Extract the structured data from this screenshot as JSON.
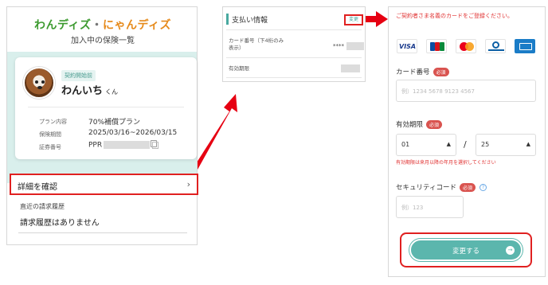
{
  "colors": {
    "accent": "#5bb6ad",
    "highlight": "#e02020",
    "logo_green": "#3c9a2f",
    "logo_orange": "#e68a1b"
  },
  "panel1": {
    "logo_left": "わんディズ",
    "logo_dot": "・",
    "logo_right": "にゃんディズ",
    "subtitle": "加入中の保険一覧",
    "card": {
      "badge": "契約開始前",
      "pet_name": "わんいち",
      "pet_suffix": "くん",
      "rows": [
        {
          "label": "プラン内容",
          "value": "70%補償プラン"
        },
        {
          "label": "保険期間",
          "value": "2025/03/16~2026/03/15"
        },
        {
          "label": "証券番号",
          "value": "PPR"
        }
      ],
      "copy_icon": "copy-icon"
    },
    "details_label": "詳細を確認",
    "details_icon": "chevron-right-icon",
    "billing_heading": "直近の請求履歴",
    "billing_text": "請求履歴はありません"
  },
  "panel2": {
    "title": "支払い情報",
    "change_label": "変更",
    "card_number_label_1": "カード番号（下4桁のみ",
    "card_number_label_2": "表示）",
    "card_number_value": "****",
    "expiry_label": "有効期限"
  },
  "panel3": {
    "notice": "ご契約者さま名義のカードをご登録ください。",
    "card_brands": [
      "VISA",
      "JCB",
      "Mastercard",
      "Diners Club",
      "American Express"
    ],
    "card_number": {
      "label": "カード番号",
      "required": "必須",
      "placeholder": "例）1234 5678 9123 4567"
    },
    "expiry": {
      "label": "有効期限",
      "required": "必須",
      "month": "01",
      "year": "25",
      "separator": "/",
      "hint": "有効期限は来月以降の年月を選択してください"
    },
    "security": {
      "label": "セキュリティコード",
      "required": "必須",
      "placeholder": "例）123",
      "help_icon": "question-icon"
    },
    "submit_label": "変更する",
    "submit_icon": "arrow-right-icon"
  }
}
